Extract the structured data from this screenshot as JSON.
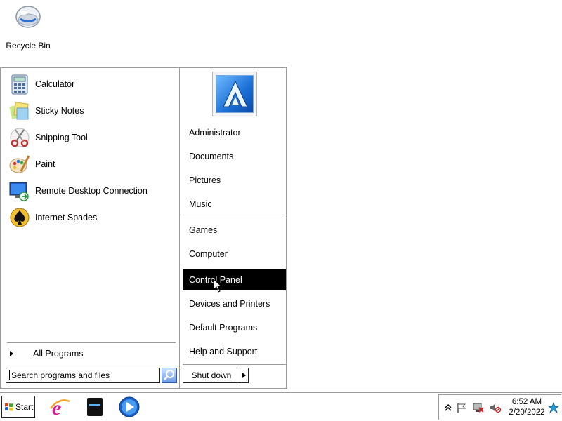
{
  "desktop": {
    "icons": [
      {
        "label": "Recycle Bin",
        "icon": "recycle-bin-icon"
      }
    ]
  },
  "start_menu": {
    "programs": [
      {
        "label": "Calculator",
        "icon": "calculator-icon"
      },
      {
        "label": "Sticky Notes",
        "icon": "sticky-notes-icon"
      },
      {
        "label": "Snipping Tool",
        "icon": "scissors-icon"
      },
      {
        "label": "Paint",
        "icon": "paint-palette-icon"
      },
      {
        "label": "Remote Desktop Connection",
        "icon": "remote-desktop-icon"
      },
      {
        "label": "Internet Spades",
        "icon": "spades-icon"
      }
    ],
    "all_programs_label": "All Programs",
    "search_placeholder": "Search programs and files",
    "right_items": [
      {
        "label": "Administrator"
      },
      {
        "label": "Documents"
      },
      {
        "label": "Pictures"
      },
      {
        "label": "Music"
      },
      {
        "label": "Games"
      },
      {
        "label": "Computer"
      },
      {
        "label": "Control Panel",
        "selected": true
      },
      {
        "label": "Devices and Printers"
      },
      {
        "label": "Default Programs"
      },
      {
        "label": "Help and Support"
      }
    ],
    "shutdown_label": "Shut down"
  },
  "taskbar": {
    "start_label": "Start",
    "pinned": [
      {
        "icon": "internet-explorer-icon"
      },
      {
        "icon": "file-explorer-icon"
      },
      {
        "icon": "media-player-icon"
      }
    ],
    "tray": {
      "time": "6:52 AM",
      "date": "2/20/2022"
    }
  },
  "colors": {
    "selection_bg": "#000000",
    "selection_fg": "#ffffff",
    "border": "#9a9a9a"
  }
}
